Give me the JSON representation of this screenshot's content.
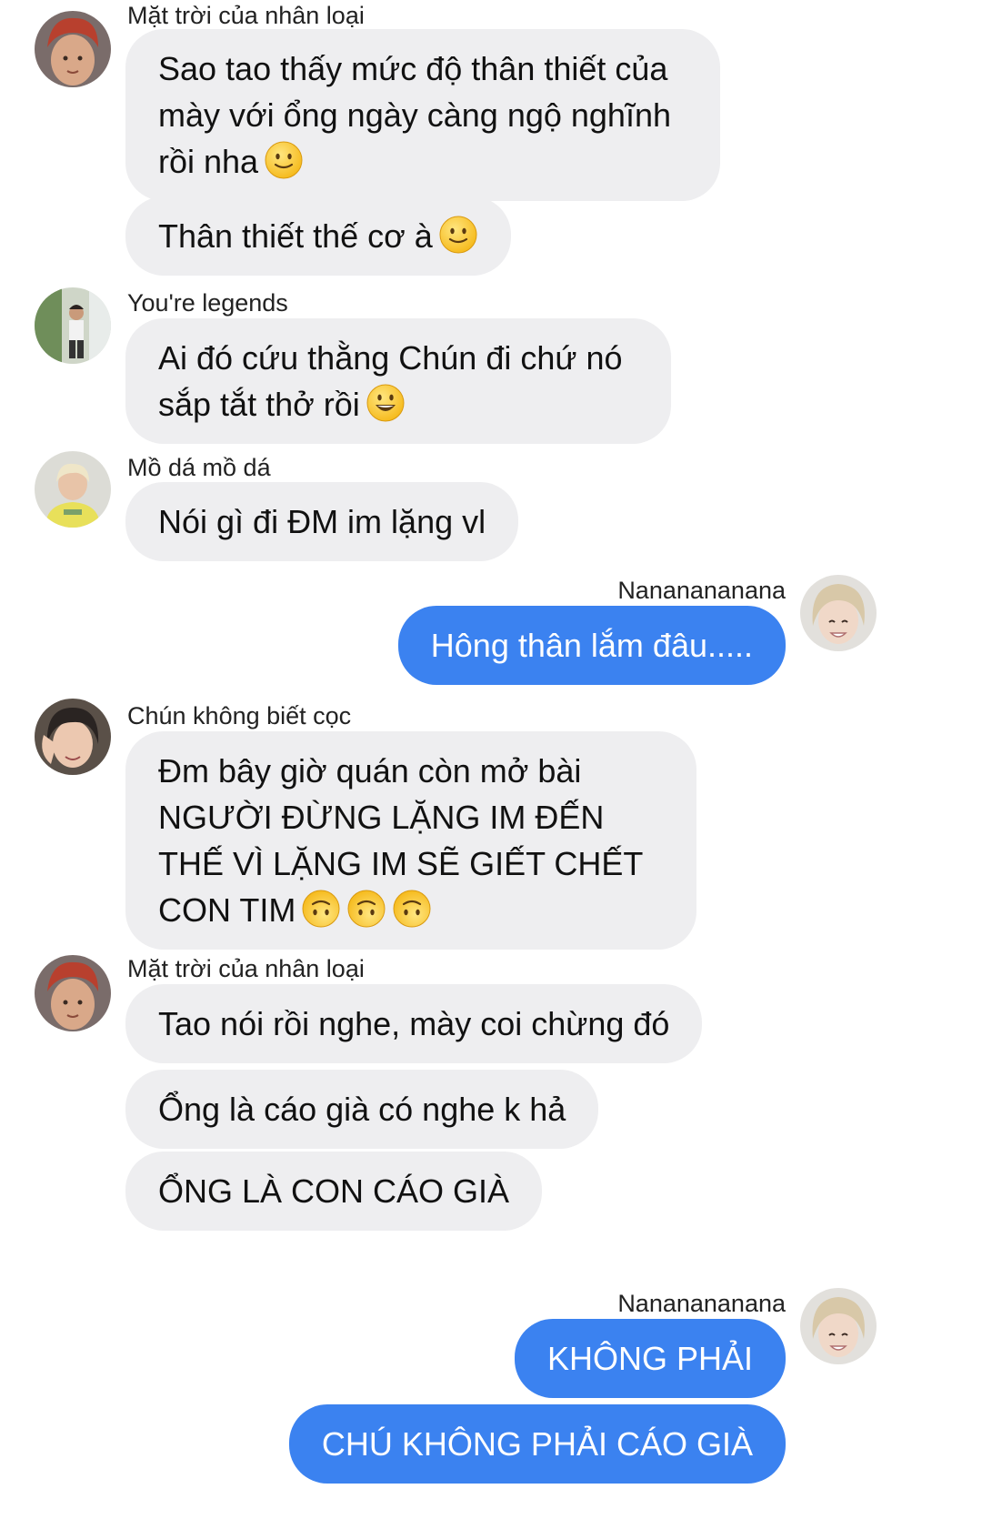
{
  "messages": [
    {
      "sender": "Mặt trời của nhân loại",
      "text": "Sao tao thấy mức độ thân thiết của mày với ổng ngày càng ngộ nghĩnh rồi nha",
      "emoji": "slightly-smiling-face"
    },
    {
      "text": "Thân thiết thế cơ à",
      "emoji": "slightly-smiling-face"
    },
    {
      "sender": "You're legends",
      "text": "Ai đó cứu thằng Chún đi chứ nó sắp tắt thở rồi",
      "emoji": "grinning-face"
    },
    {
      "sender": "Mồ dá mồ dá",
      "text": "Nói gì đi ĐM im lặng vl"
    },
    {
      "sender": "Nananananana",
      "text": "Hông thân lắm đâu....."
    },
    {
      "sender": "Chún không biết cọc",
      "text": "Đm bây giờ quán còn mở bài NGƯỜI ĐỪNG LẶNG IM ĐẾN THẾ VÌ LẶNG IM SẼ GIẾT CHẾT CON TIM",
      "emoji": "upside-down-face"
    },
    {
      "sender": "Mặt trời của nhân loại",
      "text": "Tao nói rồi nghe, mày coi chừng đó"
    },
    {
      "text": "Ổng là cáo già có nghe k hả"
    },
    {
      "text": "ỔNG LÀ CON CÁO GIÀ"
    },
    {
      "sender": "Nananananana",
      "text": "KHÔNG PHẢI"
    },
    {
      "text": "CHÚ KHÔNG PHẢI CÁO GIÀ"
    }
  ],
  "colors": {
    "incoming_bubble": "#eeeef0",
    "outgoing_bubble": "#3b82f0",
    "outgoing_text": "#ffffff"
  }
}
